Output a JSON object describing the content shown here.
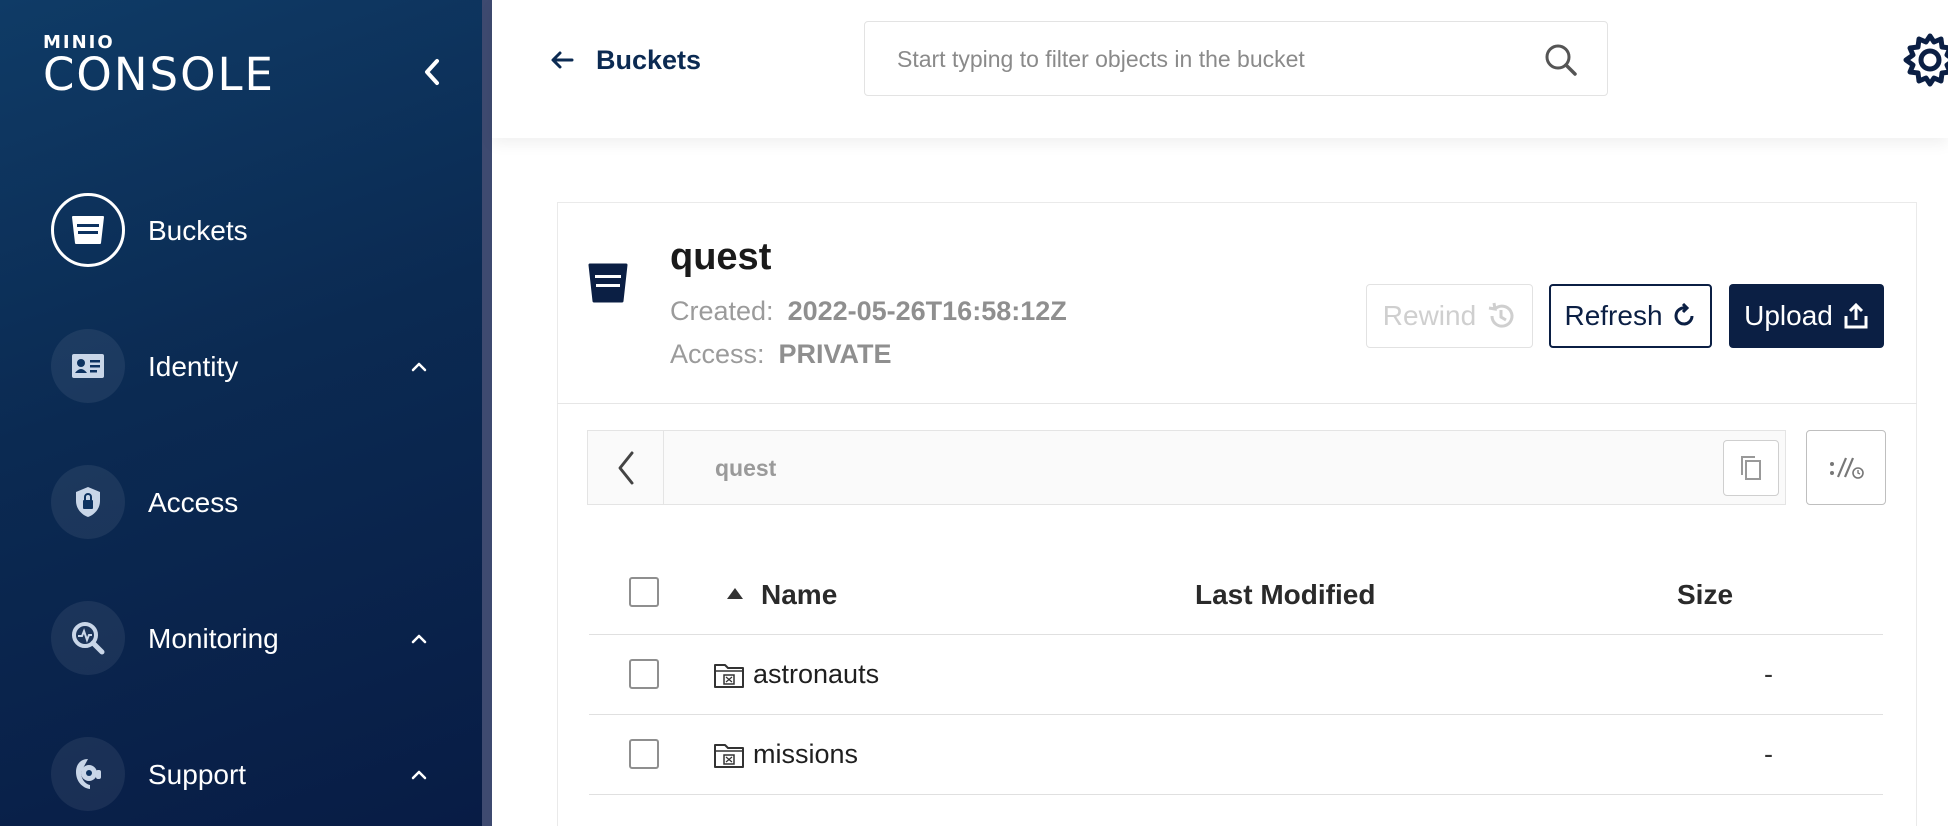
{
  "brand": {
    "small": "MINIO",
    "big": "CONSOLE"
  },
  "sidebar": {
    "items": [
      {
        "label": "Buckets",
        "icon": "bucket-icon",
        "active": true
      },
      {
        "label": "Identity",
        "icon": "id-card-icon",
        "expandable": true
      },
      {
        "label": "Access",
        "icon": "shield-lock-icon"
      },
      {
        "label": "Monitoring",
        "icon": "monitor-search-icon",
        "expandable": true
      },
      {
        "label": "Support",
        "icon": "headset-icon",
        "expandable": true
      }
    ]
  },
  "header": {
    "back_label": "Buckets",
    "search_placeholder": "Start typing to filter objects in the bucket"
  },
  "bucket": {
    "name": "quest",
    "created_label": "Created:",
    "created_value": "2022-05-26T16:58:12Z",
    "access_label": "Access:",
    "access_value": "PRIVATE"
  },
  "actions": {
    "rewind": "Rewind",
    "refresh": "Refresh",
    "upload": "Upload"
  },
  "breadcrumb": {
    "path": "quest"
  },
  "table": {
    "columns": [
      "Name",
      "Last Modified",
      "Size"
    ],
    "rows": [
      {
        "name": "astronauts",
        "last_modified": "",
        "size": "-"
      },
      {
        "name": "missions",
        "last_modified": "",
        "size": "-"
      }
    ]
  },
  "colors": {
    "sidebar_bg": "#0b2a52",
    "primary": "#0b1f44",
    "muted_text": "#9b9b9b"
  }
}
